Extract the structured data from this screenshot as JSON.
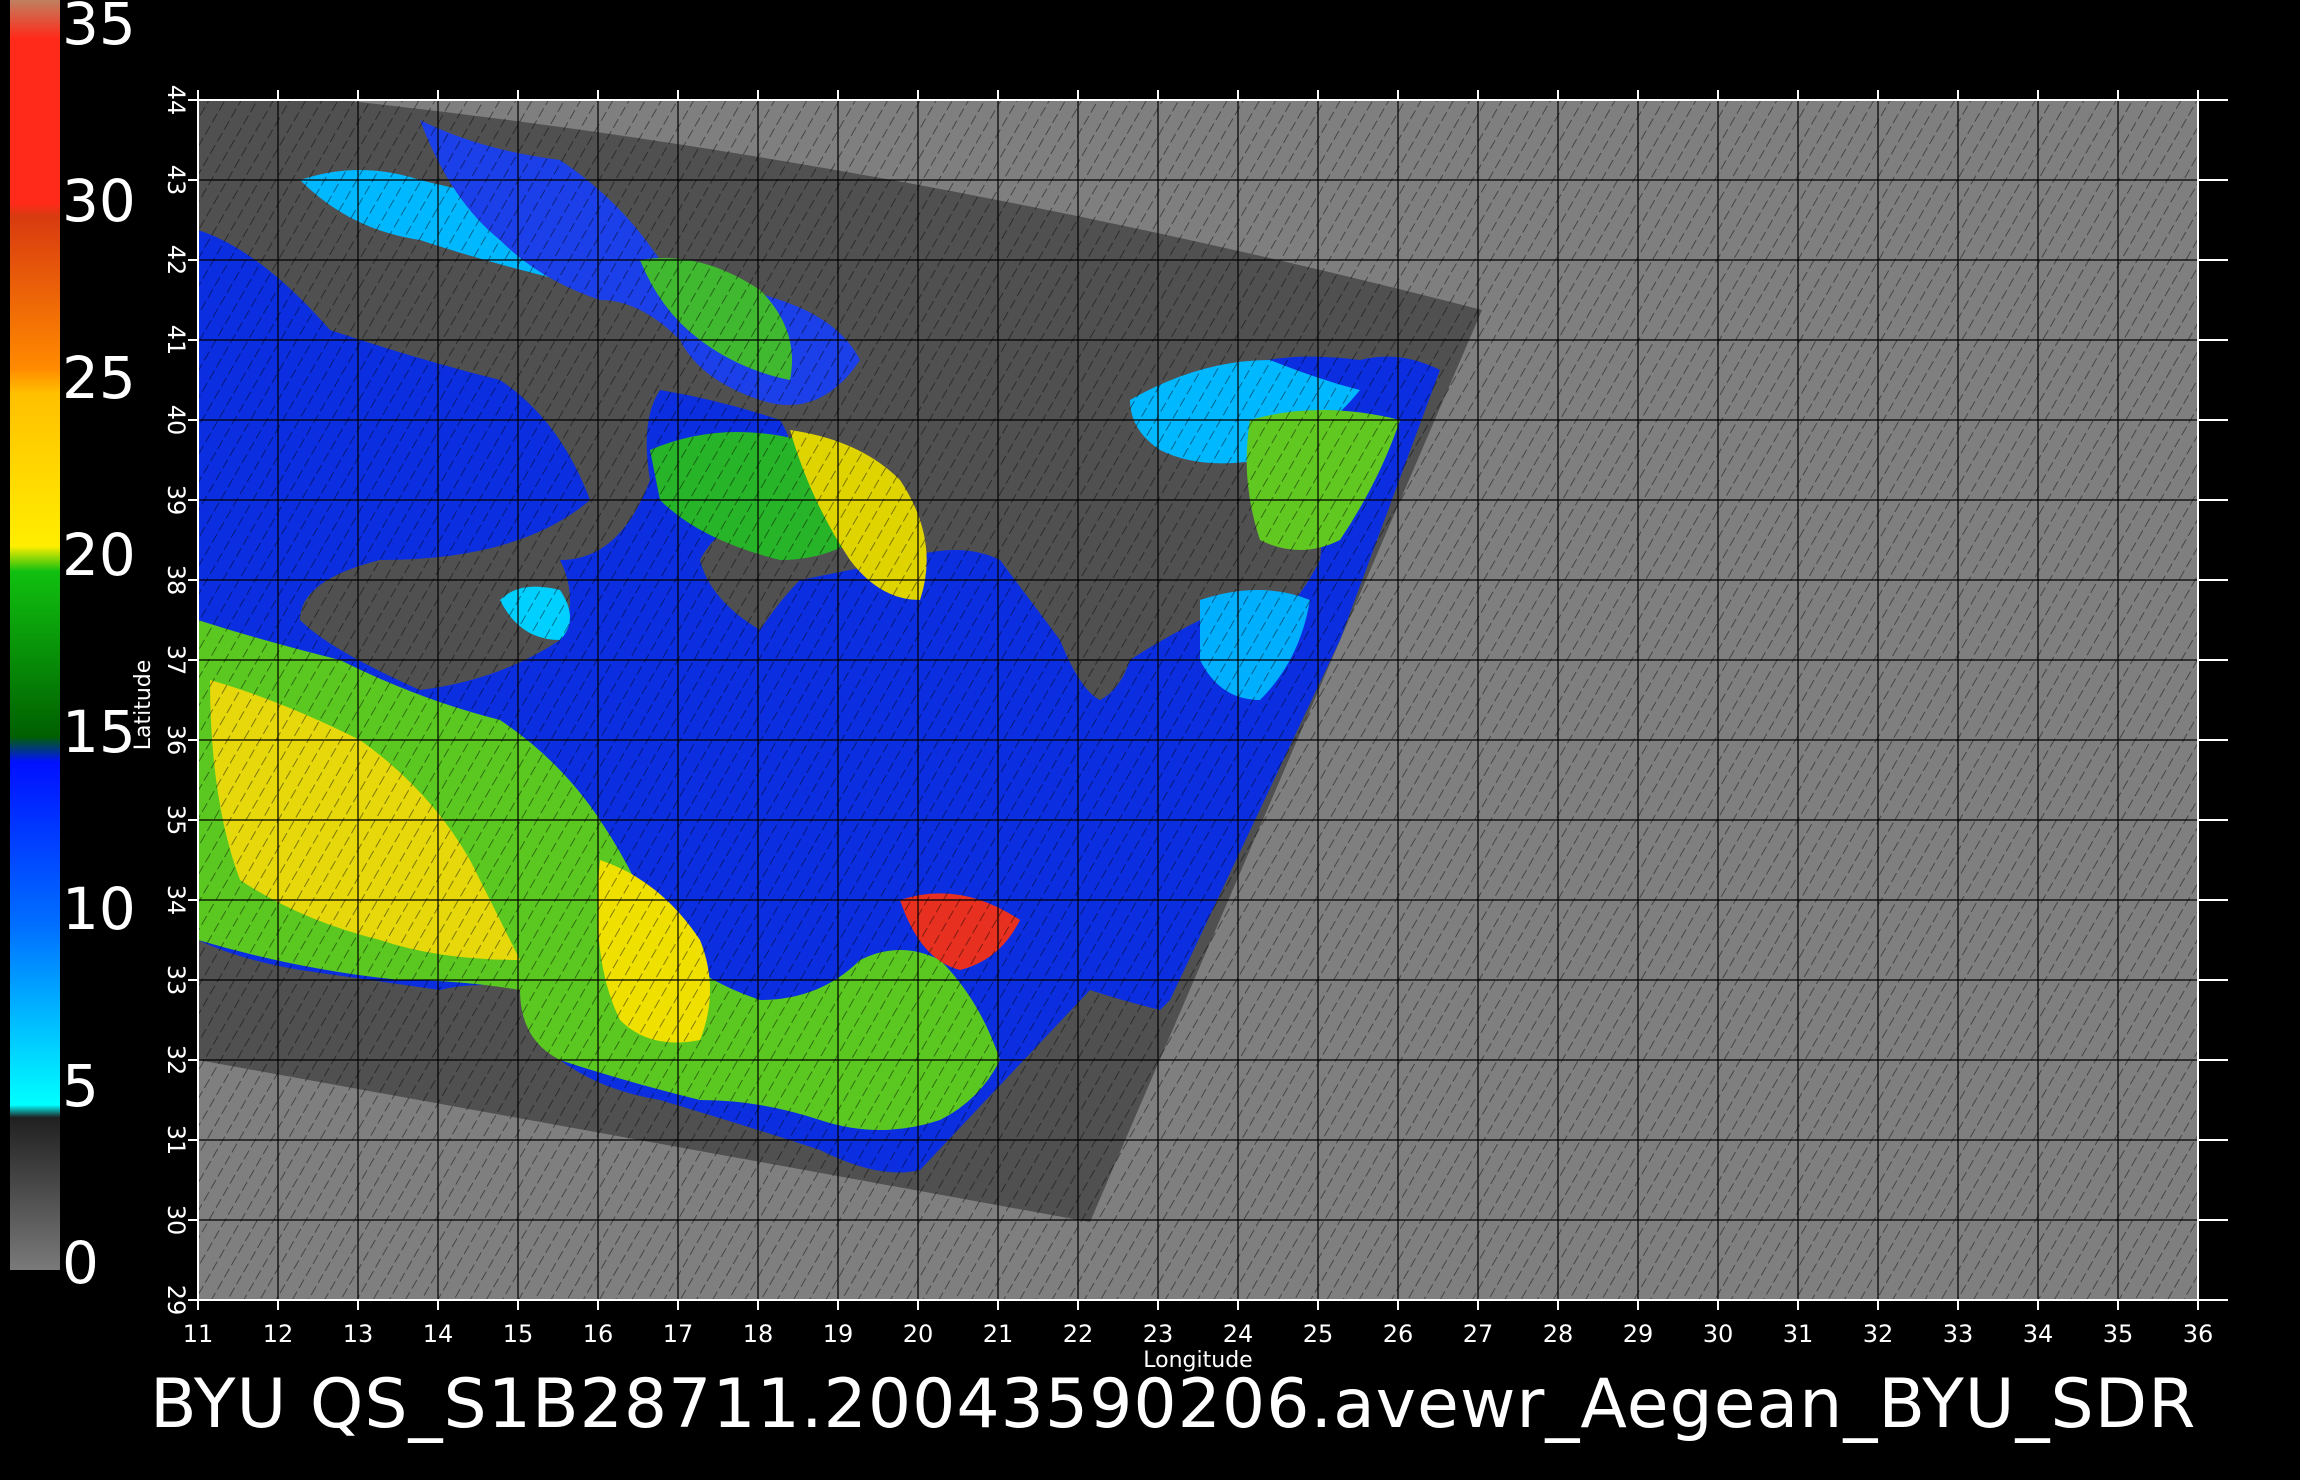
{
  "colorbar": {
    "ticks": [
      "35",
      "30",
      "25",
      "20",
      "15",
      "10",
      "5",
      "0"
    ],
    "stops": [
      "#c08060",
      "#ff2a1a",
      "#ff3a10",
      "#ff8a00",
      "#ffcc00",
      "#ffee00",
      "#20c020",
      "#008800",
      "#0020ff",
      "#0060ff",
      "#00c0ff",
      "#00ffff",
      "#202020",
      "#707070"
    ]
  },
  "map": {
    "x_axis_label": "Longitude",
    "y_axis_label": "Latitude",
    "lon_ticks": [
      "11",
      "12",
      "13",
      "14",
      "15",
      "16",
      "17",
      "18",
      "19",
      "20",
      "21",
      "22",
      "23",
      "24",
      "25",
      "26",
      "27",
      "28",
      "29",
      "30",
      "31",
      "32",
      "33",
      "34",
      "35",
      "36"
    ],
    "lat_ticks": [
      "44",
      "43",
      "42",
      "41",
      "40",
      "39",
      "38",
      "37",
      "36",
      "35",
      "34",
      "33",
      "32",
      "31",
      "30",
      "29"
    ],
    "lon_range": [
      11,
      36
    ],
    "lat_range": [
      29,
      44
    ],
    "grid": true,
    "colors": {
      "background": "#7f7f7f",
      "swath": "#505050",
      "land": "#5a5a5a",
      "grid": "#000000"
    }
  },
  "caption": "BYU  QS_S1B28711.20043590206.avewr_Aegean_BYU_SDR"
}
